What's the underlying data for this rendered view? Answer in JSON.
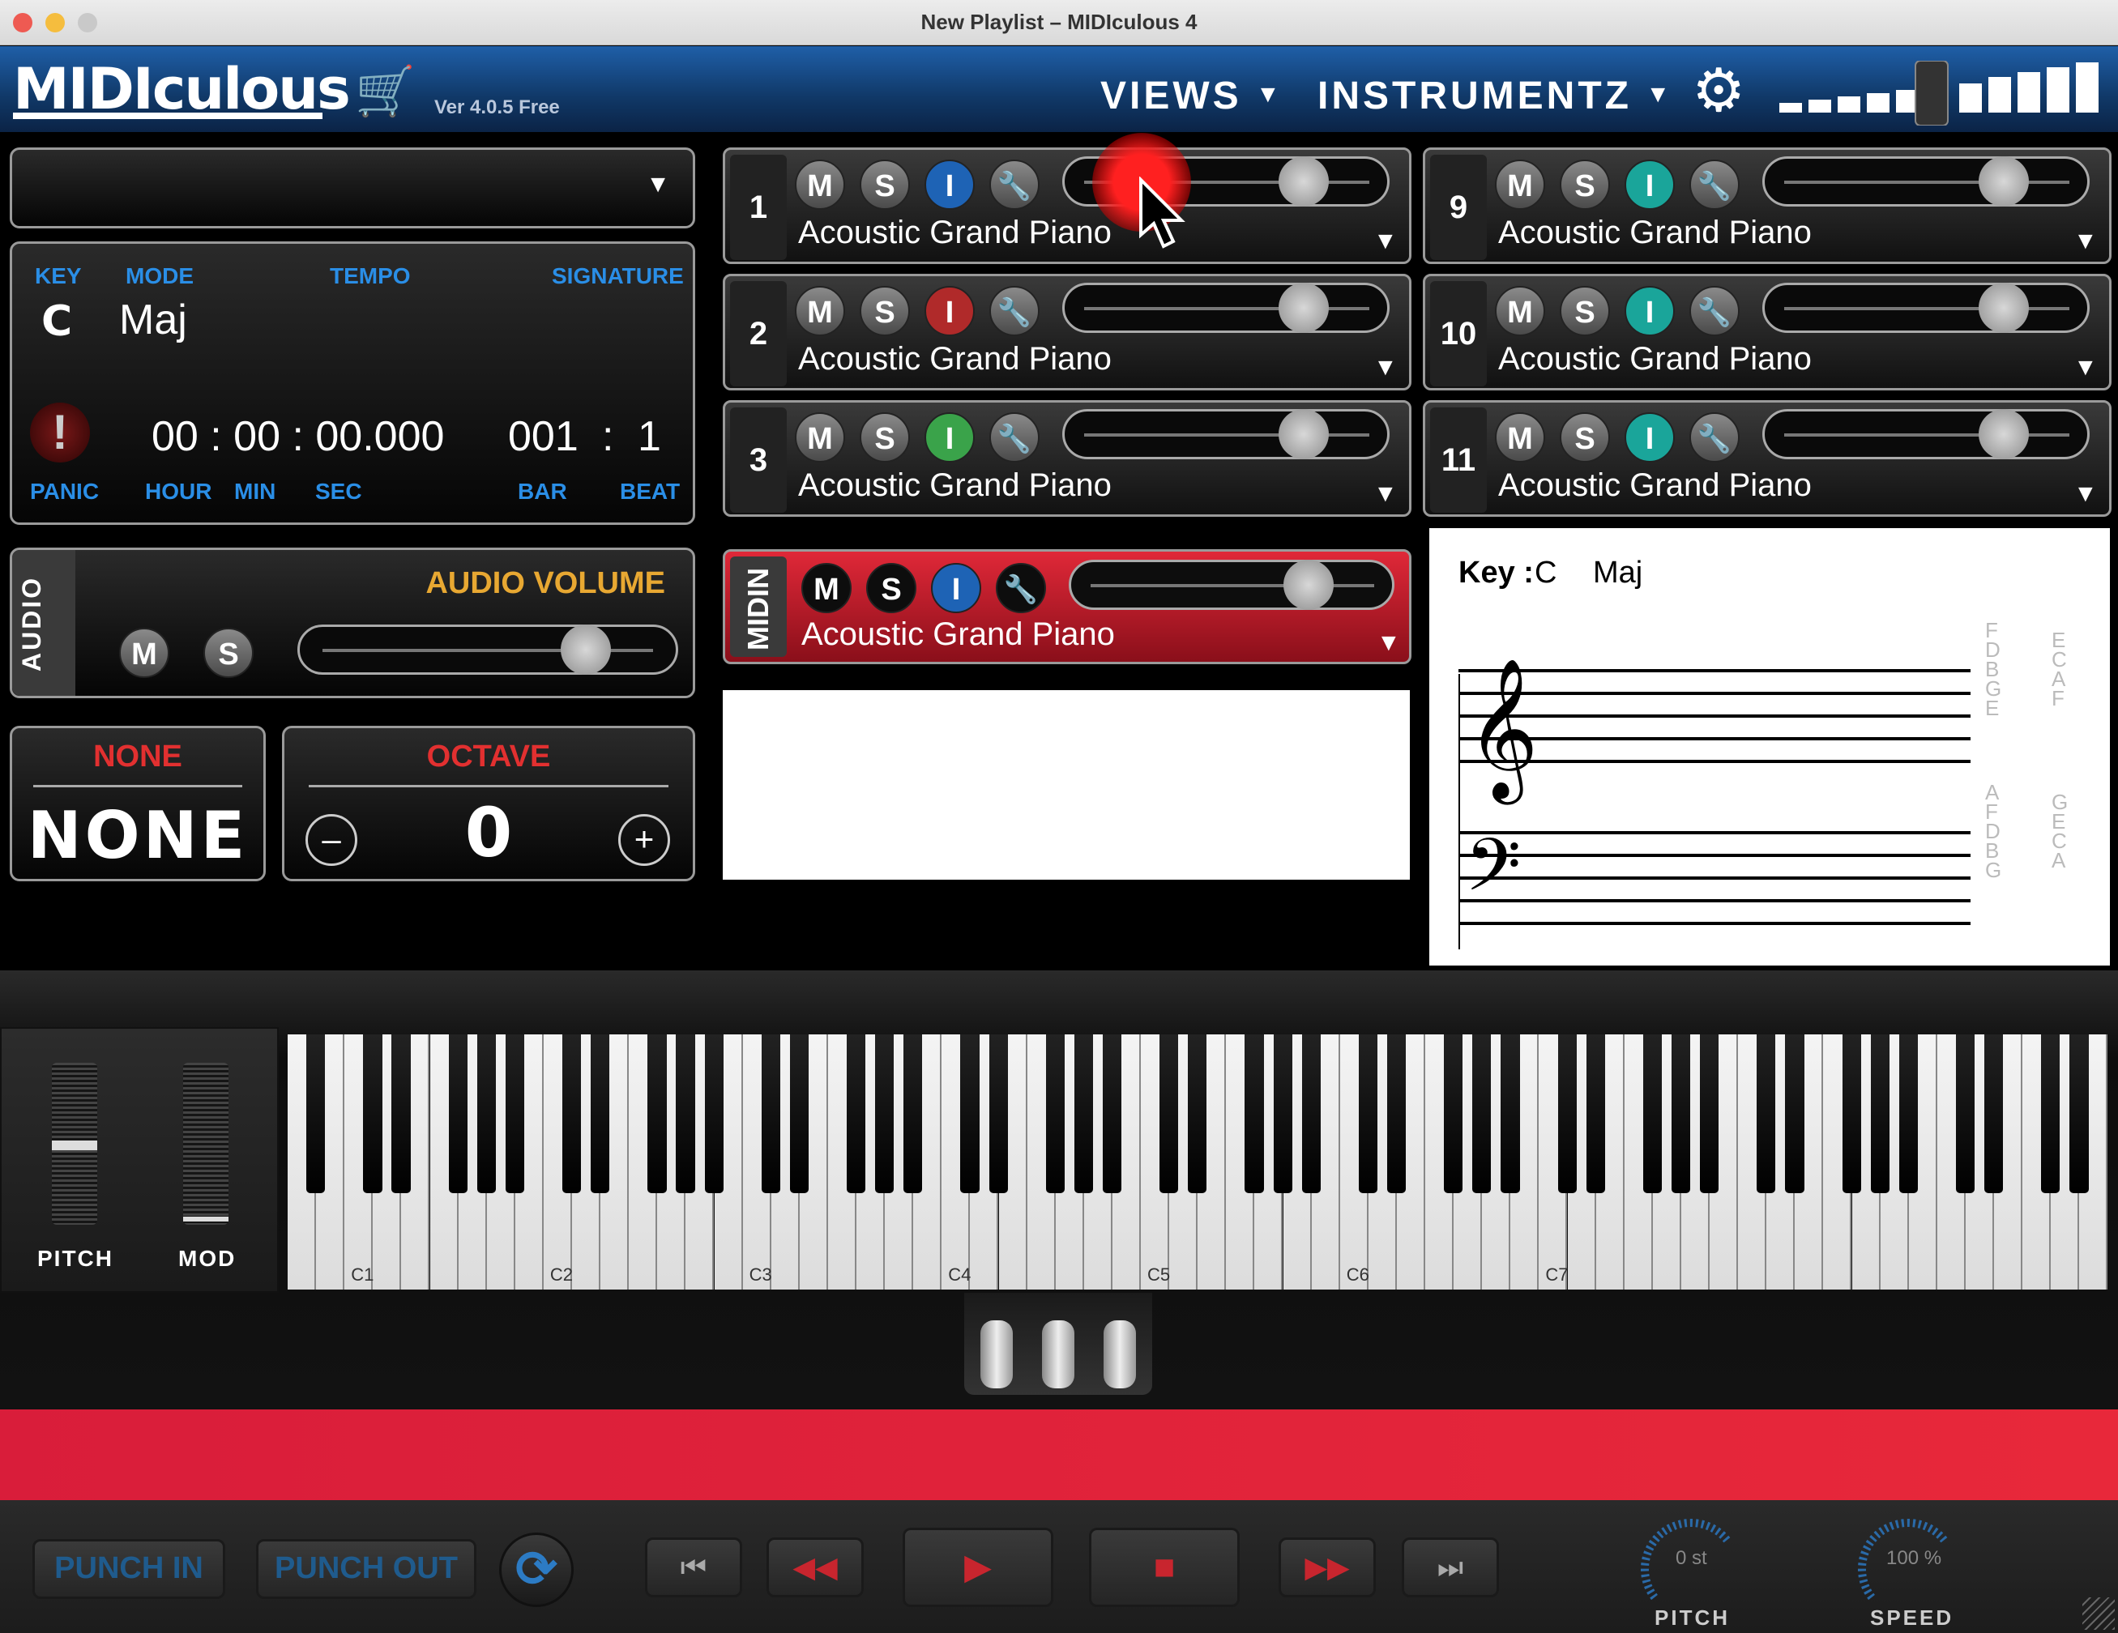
{
  "window": {
    "title": "New Playlist – MIDIculous 4"
  },
  "header": {
    "logo": "MIDIculous",
    "version": "Ver 4.0.5 Free",
    "views_label": "VIEWS",
    "instruments_label": "INSTRUMENTZ"
  },
  "info": {
    "key_label": "KEY",
    "mode_label": "MODE",
    "tempo_label": "TEMPO",
    "signature_label": "SIGNATURE",
    "key": "C",
    "mode": "Maj",
    "time": "00 : 00 : 00.000",
    "bar": "001",
    "bar_sep": ":",
    "beat": "1",
    "panic_label": "PANIC",
    "hour_label": "HOUR",
    "min_label": "MIN",
    "sec_label": "SEC",
    "bar_label": "BAR",
    "beat_label": "BEAT"
  },
  "audio": {
    "side_label": "AUDIO",
    "volume_label": "AUDIO VOLUME",
    "mute": "M",
    "solo": "S",
    "volume_level": 0.85
  },
  "chord": {
    "title": "NONE",
    "value": "NONE"
  },
  "octave": {
    "title": "OCTAVE",
    "value": "0",
    "minus": "–",
    "plus": "+"
  },
  "tracks": [
    {
      "num": "1",
      "m": "M",
      "s": "S",
      "i": "I",
      "name": "Acoustic Grand Piano",
      "i_color": "#1e63b5",
      "level": 0.8
    },
    {
      "num": "2",
      "m": "M",
      "s": "S",
      "i": "I",
      "name": "Acoustic Grand Piano",
      "i_color": "#b02a2a",
      "level": 0.8
    },
    {
      "num": "3",
      "m": "M",
      "s": "S",
      "i": "I",
      "name": "Acoustic Grand Piano",
      "i_color": "#3aa34a",
      "level": 0.8
    },
    {
      "num": "9",
      "m": "M",
      "s": "S",
      "i": "I",
      "name": "Acoustic Grand Piano",
      "i_color": "#1aa59a",
      "level": 0.8
    },
    {
      "num": "10",
      "m": "M",
      "s": "S",
      "i": "I",
      "name": "Acoustic Grand Piano",
      "i_color": "#1aa59a",
      "level": 0.8
    },
    {
      "num": "11",
      "m": "M",
      "s": "S",
      "i": "I",
      "name": "Acoustic Grand Piano",
      "i_color": "#1aa59a",
      "level": 0.8
    }
  ],
  "midin": {
    "label": "MIDIN",
    "m": "M",
    "s": "S",
    "i": "I",
    "name": "Acoustic Grand Piano",
    "level": 0.8
  },
  "staff": {
    "key_label": "Key :",
    "key": "C",
    "mode": "Maj",
    "treble_lines": "F D B G E",
    "treble_spaces": "E C A F",
    "bass_lines": "A F D B G",
    "bass_spaces": "G E C A"
  },
  "wheels": {
    "pitch_label": "PITCH",
    "mod_label": "MOD"
  },
  "keyboard": {
    "octaves": [
      "C1",
      "C2",
      "C3",
      "C4",
      "C5",
      "C6",
      "C7"
    ]
  },
  "transport": {
    "punch_in": "PUNCH IN",
    "punch_out": "PUNCH OUT",
    "pitch_value": "0 st",
    "pitch_label": "PITCH",
    "speed_value": "100 %",
    "speed_label": "SPEED"
  }
}
